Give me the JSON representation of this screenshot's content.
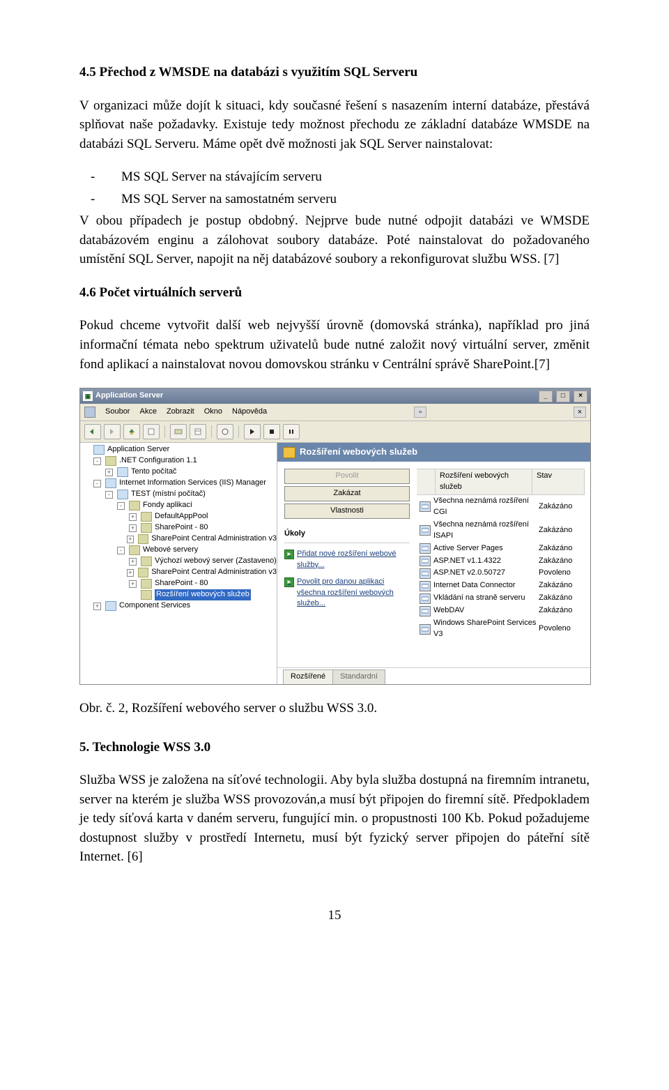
{
  "sections": {
    "s45": {
      "heading": "4.5   Přechod z WMSDE na databázi s využitím SQL Serveru",
      "p1": "V organizaci může dojít k situaci, kdy současné řešení s nasazením interní databáze, přestává splňovat naše požadavky. Existuje tedy možnost přechodu ze základní databáze WMSDE na databázi SQL Serveru. Máme opět dvě možnosti jak SQL Server nainstalovat:",
      "bullet1": "MS SQL Server na stávajícím serveru",
      "bullet2": "MS SQL Server na samostatném serveru",
      "p2": "V obou případech je postup obdobný. Nejprve bude nutné odpojit databázi ve WMSDE databázovém enginu a zálohovat soubory databáze. Poté nainstalovat do požadovaného umístění SQL Server, napojit na něj databázové soubory a rekonfigurovat službu WSS. [7]"
    },
    "s46": {
      "heading": "4.6   Počet virtuálních serverů",
      "p1": "Pokud chceme vytvořit další web nejvyšší úrovně (domovská stránka), například pro jiná informační témata nebo spektrum uživatelů bude nutné založit nový virtuální server, změnit fond aplikací a nainstalovat novou domovskou stránku v Centrální správě SharePoint.[7]"
    },
    "caption": "Obr. č. 2, Rozšíření webového server o službu WSS 3.0.",
    "s5": {
      "heading": "5.   Technologie WSS 3.0",
      "p1": "Služba WSS je založena na síťové technologii. Aby byla služba dostupná na firemním intranetu, server na kterém je služba WSS provozován,a musí být připojen do firemní sítě. Předpokladem je tedy síťová karta v daném serveru, fungující min. o propustnosti 100 Kb. Pokud požadujeme dostupnost služby v prostředí Internetu, musí být fyzický server připojen do páteřní sítě Internet. [6]"
    }
  },
  "app": {
    "title": "Application Server",
    "menu": [
      "Soubor",
      "Akce",
      "Zobrazit",
      "Okno",
      "Nápověda"
    ],
    "tree": [
      {
        "l": 0,
        "exp": "",
        "icon": "file",
        "label": "Application Server"
      },
      {
        "l": 1,
        "exp": "-",
        "icon": "folder",
        "label": ".NET Configuration 1.1"
      },
      {
        "l": 2,
        "exp": "+",
        "icon": "file",
        "label": "Tento počítač"
      },
      {
        "l": 1,
        "exp": "-",
        "icon": "file",
        "label": "Internet Information Services (IIS) Manager"
      },
      {
        "l": 2,
        "exp": "-",
        "icon": "file",
        "label": "TEST (místní počítač)"
      },
      {
        "l": 3,
        "exp": "-",
        "icon": "folder",
        "label": "Fondy aplikací"
      },
      {
        "l": 4,
        "exp": "+",
        "icon": "folder",
        "label": "DefaultAppPool"
      },
      {
        "l": 4,
        "exp": "+",
        "icon": "folder",
        "label": "SharePoint - 80"
      },
      {
        "l": 4,
        "exp": "+",
        "icon": "folder",
        "label": "SharePoint Central Administration v3"
      },
      {
        "l": 3,
        "exp": "-",
        "icon": "folder",
        "label": "Webové servery"
      },
      {
        "l": 4,
        "exp": "+",
        "icon": "folder",
        "label": "Výchozí webový server (Zastaveno)"
      },
      {
        "l": 4,
        "exp": "+",
        "icon": "folder",
        "label": "SharePoint Central Administration v3"
      },
      {
        "l": 4,
        "exp": "+",
        "icon": "folder",
        "label": "SharePoint - 80"
      },
      {
        "l": 4,
        "exp": "",
        "icon": "folder",
        "label": "Rozšíření webových služeb",
        "sel": true
      },
      {
        "l": 1,
        "exp": "+",
        "icon": "file",
        "label": "Component Services"
      }
    ],
    "detail_title": "Rozšíření webových služeb",
    "buttons": {
      "b1": "Povolit",
      "b2": "Zakázat",
      "b3": "Vlastnosti"
    },
    "tasks_title": "Úkoly",
    "task1": "Přidat nové rozšíření webové služby...",
    "task2": "Povolit pro danou aplikaci všechna rozšíření webových služeb...",
    "listcols": {
      "a": "",
      "b": "Rozšíření webových služeb",
      "c": "Stav"
    },
    "list": [
      {
        "name": "Všechna neznámá rozšíření CGI",
        "stat": "Zakázáno"
      },
      {
        "name": "Všechna neznámá rozšíření ISAPI",
        "stat": "Zakázáno"
      },
      {
        "name": "Active Server Pages",
        "stat": "Zakázáno"
      },
      {
        "name": "ASP.NET v1.1.4322",
        "stat": "Zakázáno"
      },
      {
        "name": "ASP.NET v2.0.50727",
        "stat": "Povoleno"
      },
      {
        "name": "Internet Data Connector",
        "stat": "Zakázáno"
      },
      {
        "name": "Vkládání na straně serveru",
        "stat": "Zakázáno"
      },
      {
        "name": "WebDAV",
        "stat": "Zakázáno"
      },
      {
        "name": "Windows SharePoint Services V3",
        "stat": "Povoleno"
      }
    ],
    "tabs": {
      "t1": "Rozšířené",
      "t2": "Standardní"
    }
  },
  "pagenum": "15"
}
